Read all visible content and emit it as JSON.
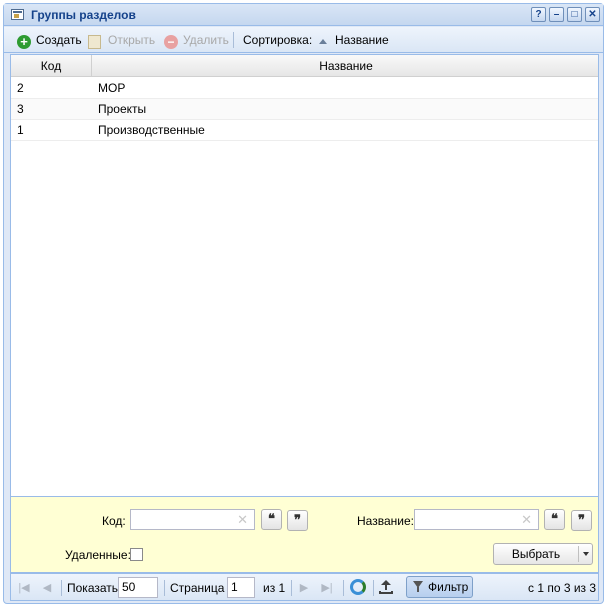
{
  "window": {
    "title": "Группы разделов",
    "tools": [
      "?",
      "–",
      "□",
      "✕"
    ]
  },
  "toolbar": {
    "create_label": "Создать",
    "open_label": "Открыть",
    "delete_label": "Удалить",
    "sort_label": "Сортировка:",
    "sort_field": "Название"
  },
  "grid": {
    "columns": [
      "Код",
      "Название"
    ],
    "rows": [
      {
        "code": "2",
        "name": "МОР"
      },
      {
        "code": "3",
        "name": "Проекты"
      },
      {
        "code": "1",
        "name": "Производственные"
      }
    ]
  },
  "filter": {
    "code_label": "Код:",
    "code_value": "",
    "name_label": "Название:",
    "name_value": "",
    "quote_open": "❝",
    "quote_close": "❞",
    "deleted_label": "Удаленные:",
    "deleted_checked": false,
    "select_label": "Выбрать"
  },
  "pager": {
    "show_label": "Показать",
    "page_size": "50",
    "page_label": "Страница",
    "page_value": "1",
    "of_label": "из 1",
    "filter_label": "Фильтр",
    "summary": "с 1 по 3 из 3"
  },
  "colors": {
    "accent": "#15428b",
    "border": "#99bbe8",
    "filter_bg": "#ffffd4"
  }
}
